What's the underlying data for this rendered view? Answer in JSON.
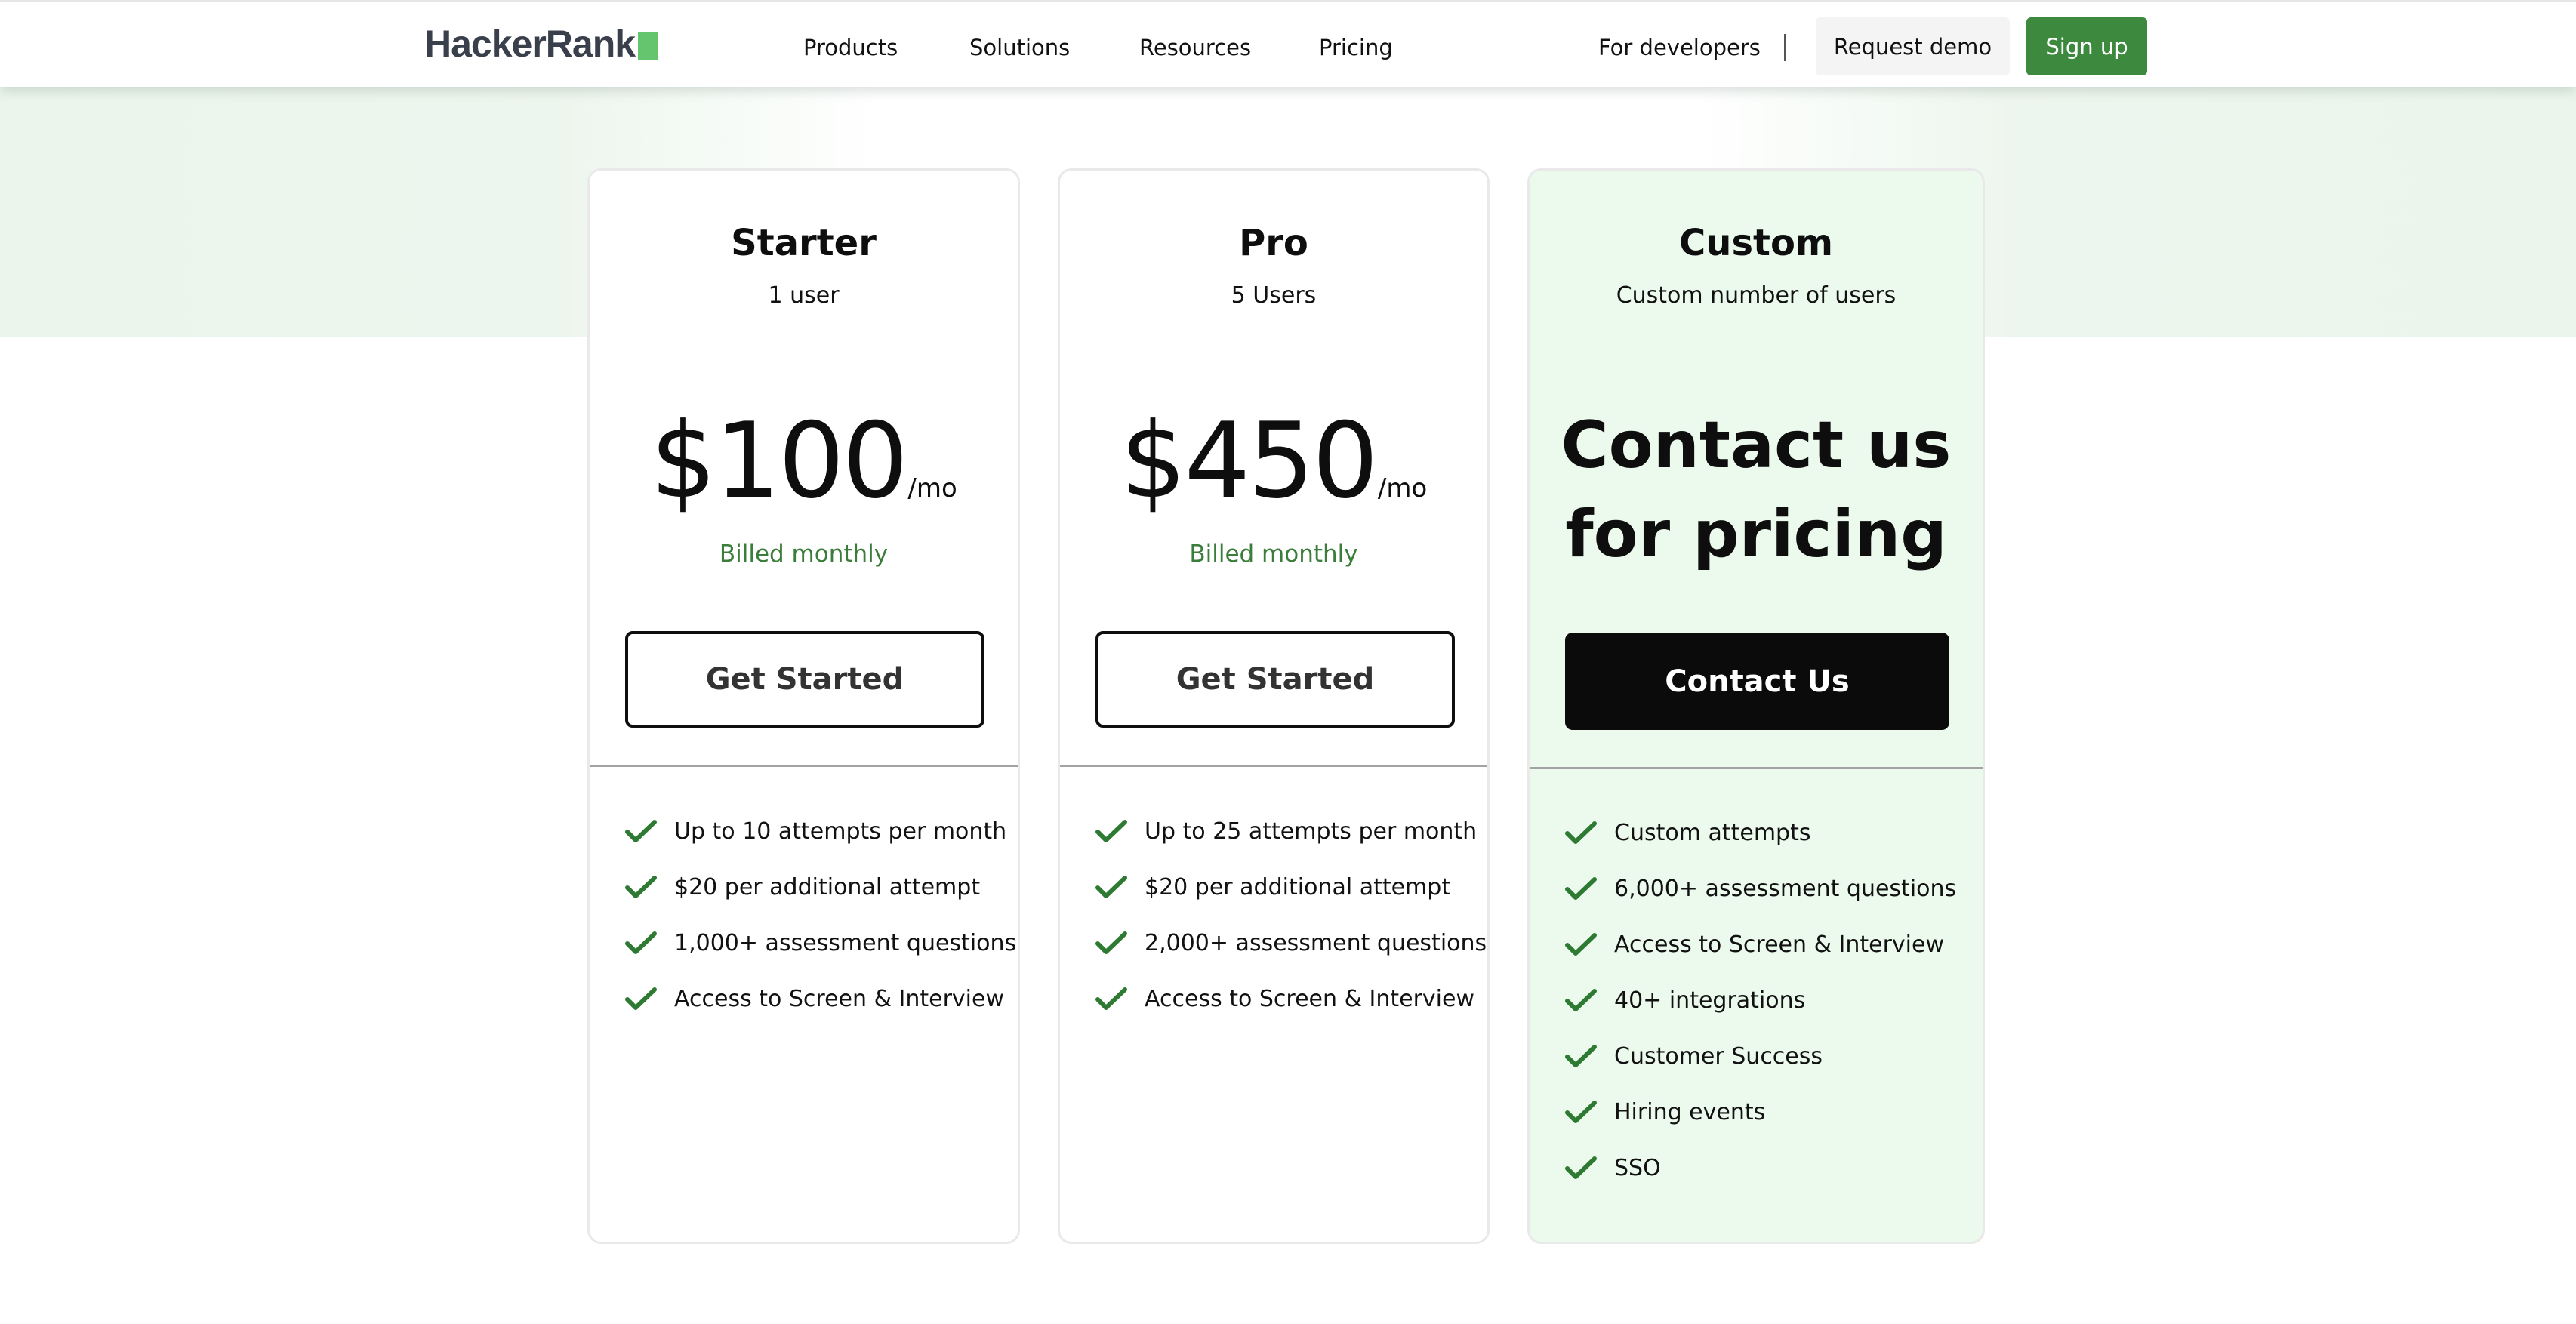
{
  "header": {
    "logo_text": "HackerRank",
    "nav": [
      "Products",
      "Solutions",
      "Resources",
      "Pricing"
    ],
    "for_developers": "For developers",
    "request_demo": "Request demo",
    "sign_up": "Sign up"
  },
  "colors": {
    "brand_green": "#3d8a3f",
    "logo_green": "#65c46e",
    "check_green": "#2f7a33",
    "billed_green": "#3b7d3a",
    "custom_card_bg": "#ebfaed"
  },
  "plans": [
    {
      "name": "Starter",
      "users": "1 user",
      "price": "$100",
      "period": "/mo",
      "billing": "Billed monthly",
      "cta": "Get Started",
      "features": [
        "Up to 10 attempts per month",
        "$20 per additional attempt",
        "1,000+ assessment questions",
        "Access to Screen & Interview"
      ]
    },
    {
      "name": "Pro",
      "users": "5 Users",
      "price": "$450",
      "period": "/mo",
      "billing": "Billed monthly",
      "cta": "Get Started",
      "features": [
        "Up to 25 attempts per month",
        "$20 per additional attempt",
        "2,000+ assessment questions",
        "Access to Screen & Interview"
      ]
    },
    {
      "name": "Custom",
      "users": "Custom number of users",
      "price_line1": "Contact us",
      "price_line2": "for pricing",
      "cta": "Contact Us",
      "features": [
        "Custom attempts",
        "6,000+ assessment questions",
        "Access to Screen & Interview",
        "40+ integrations",
        "Customer Success",
        "Hiring events",
        "SSO"
      ]
    }
  ],
  "icons": {
    "feature_check": "check-icon"
  }
}
